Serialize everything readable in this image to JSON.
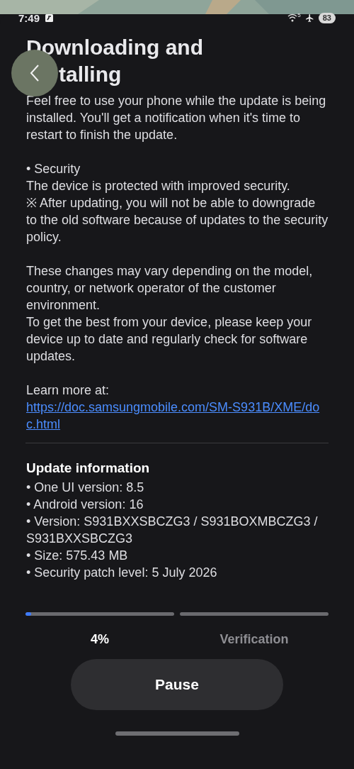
{
  "status_bar": {
    "time": "7:49",
    "wifi_band": "5",
    "battery": "83"
  },
  "title": {
    "line_1": "Downloading and",
    "line_2": "talling"
  },
  "description": "Feel free to use your phone while the update is being installed. You'll get a notification when it's time to restart to finish the update.",
  "notes": [
    {
      "lines": [
        "• Security",
        "The device is protected with improved security.",
        "※ After updating, you will not be able to downgrade to the old software because of updates to the security policy."
      ]
    },
    {
      "lines": [
        "These changes may vary depending on the model, country, or network operator of the customer environment.",
        "To get the best from your device, please keep your device up to date and regularly check for software updates."
      ]
    },
    {
      "lines": [
        "Learn more at:"
      ],
      "link": "https://doc.samsungmobile.com/SM-S931B/XME/doc.html"
    }
  ],
  "update_information": {
    "heading": "Update information",
    "items": [
      "• One UI version: 8.5",
      "• Android version: 16",
      "• Version: S931BXXSBCZG3 / S931BOXMBCZG3 / S931BXXSBCZG3",
      "• Size: 575.43 MB",
      "• Security patch level: 5 July 2026"
    ]
  },
  "progress": [
    {
      "label": "4%",
      "selected": true,
      "level": 0.04
    },
    {
      "label": "Verification",
      "selected": false,
      "level": 0
    }
  ],
  "pause_button": "Pause"
}
